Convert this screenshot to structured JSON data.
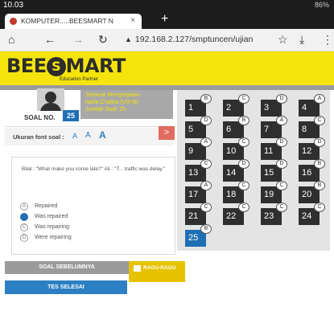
{
  "status": {
    "time": "10.03",
    "battery": "86%"
  },
  "browser": {
    "tab_title": "KOMPUTER.....BEESMART N",
    "tab_close": "×",
    "new_tab": "+",
    "url": "192.168.2.127/smptuncen/ujian"
  },
  "app": {
    "logo_left": "BEE",
    "logo_mark": "S",
    "logo_right": "MART",
    "tagline": "Education Partner",
    "greeting": [
      "Selamat Mengerjakan",
      "Naifa Chalisa (VIII-B)",
      "Jumlah Soal: 25"
    ]
  },
  "question": {
    "label": "SOAL NO.",
    "number": "25",
    "font_label": "Ukuran font soal :",
    "font_sizes": [
      "A",
      "A",
      "A"
    ],
    "next": ">",
    "text": "Bilal : \"What make you come late?\" Ali : \"T... traffic was delay.\"",
    "options": [
      {
        "letter": "A",
        "text": "Repaired",
        "selected": false
      },
      {
        "letter": "B",
        "text": "Was repaired",
        "selected": true
      },
      {
        "letter": "C",
        "text": "Was repairing",
        "selected": false
      },
      {
        "letter": "D",
        "text": "Were repairing",
        "selected": false
      }
    ]
  },
  "buttons": {
    "prev": "SOAL SEBELUMNYA",
    "ragu": "RAGU-RAGU",
    "finish": "TES SELESAI"
  },
  "nav": {
    "cells": [
      {
        "n": "1",
        "a": "B"
      },
      {
        "n": "2",
        "a": "C"
      },
      {
        "n": "3",
        "a": "D"
      },
      {
        "n": "4",
        "a": "A"
      },
      {
        "n": "5",
        "a": "D"
      },
      {
        "n": "6",
        "a": "B"
      },
      {
        "n": "7",
        "a": "A"
      },
      {
        "n": "8",
        "a": "C"
      },
      {
        "n": "9",
        "a": "A"
      },
      {
        "n": "10",
        "a": "C"
      },
      {
        "n": "11",
        "a": "D"
      },
      {
        "n": "12",
        "a": "D"
      },
      {
        "n": "13",
        "a": "C"
      },
      {
        "n": "14",
        "a": "D"
      },
      {
        "n": "15",
        "a": "D"
      },
      {
        "n": "16",
        "a": "B"
      },
      {
        "n": "17",
        "a": "A"
      },
      {
        "n": "18",
        "a": "C"
      },
      {
        "n": "19",
        "a": "C"
      },
      {
        "n": "20",
        "a": "B"
      },
      {
        "n": "21",
        "a": "C"
      },
      {
        "n": "22",
        "a": "C"
      },
      {
        "n": "23",
        "a": "C"
      },
      {
        "n": "24",
        "a": "C"
      },
      {
        "n": "25",
        "a": "B"
      }
    ],
    "current": "25"
  }
}
